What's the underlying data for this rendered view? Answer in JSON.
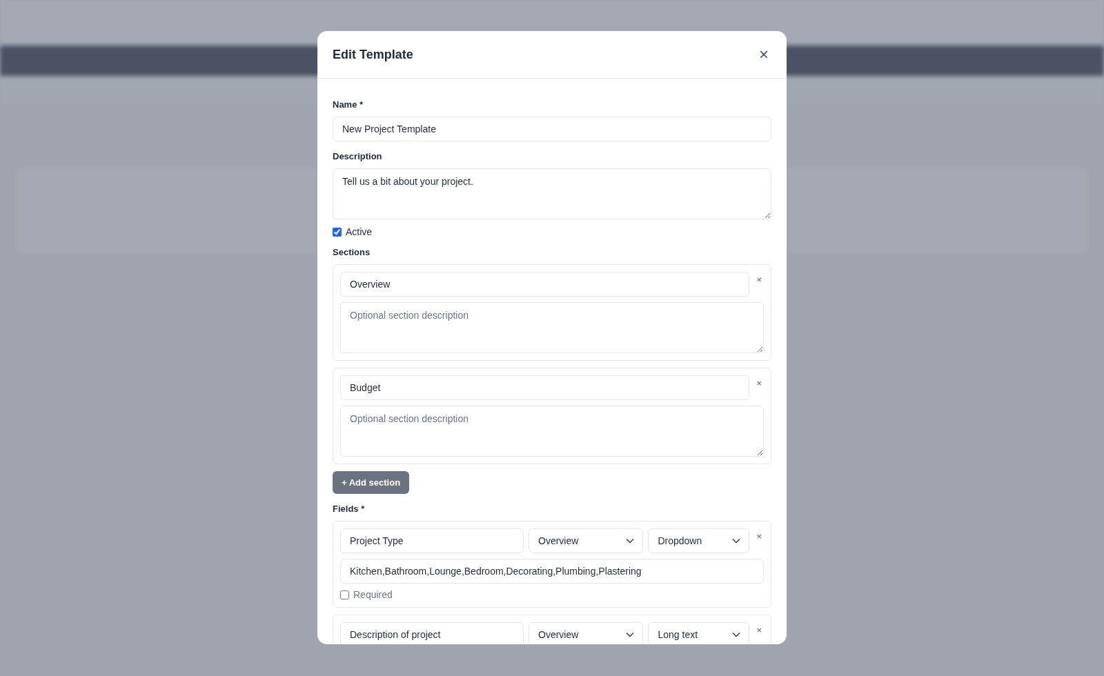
{
  "dialog": {
    "title": "Edit Template",
    "close": "×"
  },
  "name": {
    "label": "Name *",
    "value": "New Project Template"
  },
  "description": {
    "label": "Description",
    "value": "Tell us a bit about your project."
  },
  "active": {
    "label": "Active",
    "checked": true
  },
  "sections": {
    "label": "Sections",
    "items": [
      {
        "title": "Overview",
        "placeholder": "Optional section description",
        "remove": "×"
      },
      {
        "title": "Budget",
        "placeholder": "Optional section description",
        "remove": "×"
      }
    ],
    "add_button": "+ Add section"
  },
  "fields": {
    "label": "Fields *",
    "items": [
      {
        "name": "Project Type",
        "section": "Overview",
        "type": "Dropdown",
        "options": "Kitchen,Bathroom,Lounge,Bedroom,Decorating,Plumbing,Plastering",
        "required": {
          "label": "Required",
          "checked": false
        },
        "remove": "×"
      },
      {
        "name": "Description of project",
        "section": "Overview",
        "type": "Long text",
        "remove": "×"
      }
    ]
  }
}
